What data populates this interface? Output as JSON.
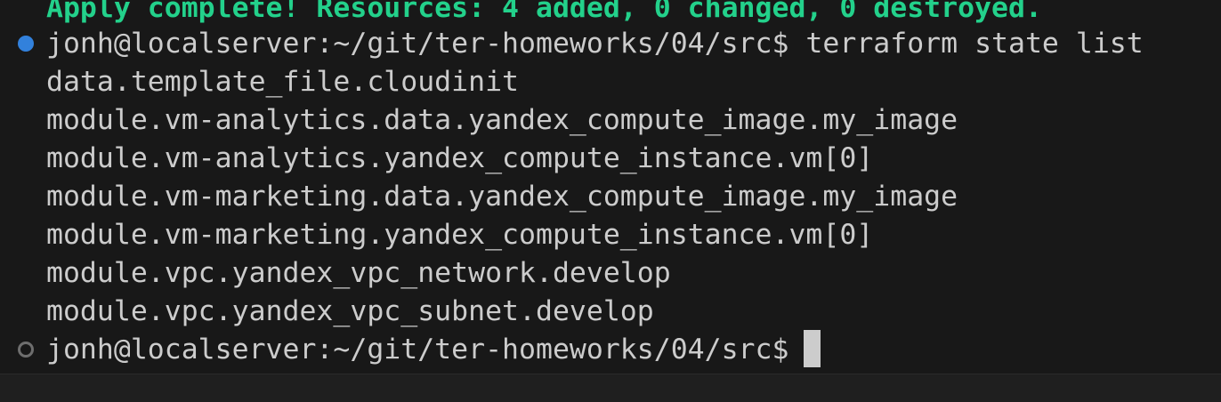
{
  "terminal": {
    "colors": {
      "background": "#181818",
      "text": "#cccccc",
      "success": "#23d18b",
      "decoration_success": "#3794ff",
      "decoration_empty": "#6e6e6e"
    },
    "apply_message": "Apply complete! Resources: 4 added, 0 changed, 0 destroyed.",
    "prompt": "jonh@localserver:~/git/ter-homeworks/04/src$",
    "command": "terraform state list",
    "output": [
      "data.template_file.cloudinit",
      "module.vm-analytics.data.yandex_compute_image.my_image",
      "module.vm-analytics.yandex_compute_instance.vm[0]",
      "module.vm-marketing.data.yandex_compute_image.my_image",
      "module.vm-marketing.yandex_compute_instance.vm[0]",
      "module.vpc.yandex_vpc_network.develop",
      "module.vpc.yandex_vpc_subnet.develop"
    ],
    "current_prompt": "jonh@localserver:~/git/ter-homeworks/04/src$",
    "icons": {
      "command_success": "command-success-dot-icon",
      "command_pending": "command-pending-circle-icon"
    }
  }
}
